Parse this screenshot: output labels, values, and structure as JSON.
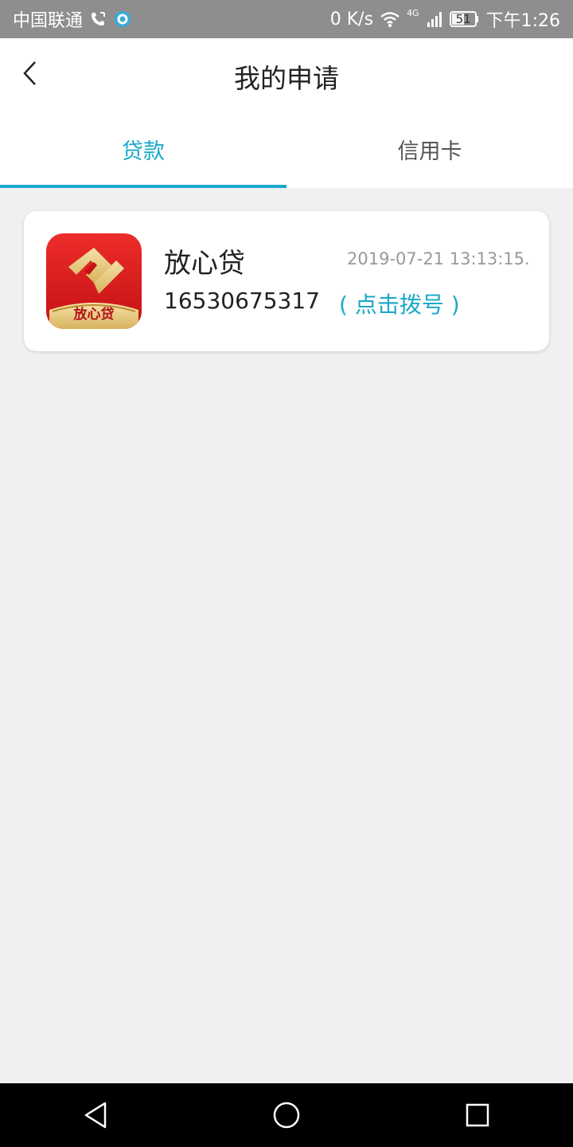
{
  "status_bar": {
    "carrier": "中国联通",
    "speed": "0 K/s",
    "network": "4G",
    "battery": "51",
    "time": "下午1:26",
    "icons": [
      "phone-call-icon",
      "app-notify-icon",
      "wifi-icon",
      "signal-icon",
      "battery-icon"
    ]
  },
  "header": {
    "title": "我的申请",
    "back_icon": "back-chevron-icon"
  },
  "tabs": [
    {
      "label": "贷款",
      "active": true
    },
    {
      "label": "信用卡",
      "active": false
    }
  ],
  "applications": [
    {
      "name": "放心贷",
      "logo_text": "放心贷",
      "time": "2019-07-21 13:13:15...",
      "phone": "16530675317",
      "dial_label": "( 点击拨号 )"
    }
  ],
  "colors": {
    "accent": "#1aa9c8",
    "logo_red": "#d9191e",
    "logo_gold": "#e8c776"
  },
  "nav": [
    "back-triangle-icon",
    "home-circle-icon",
    "recents-square-icon"
  ]
}
